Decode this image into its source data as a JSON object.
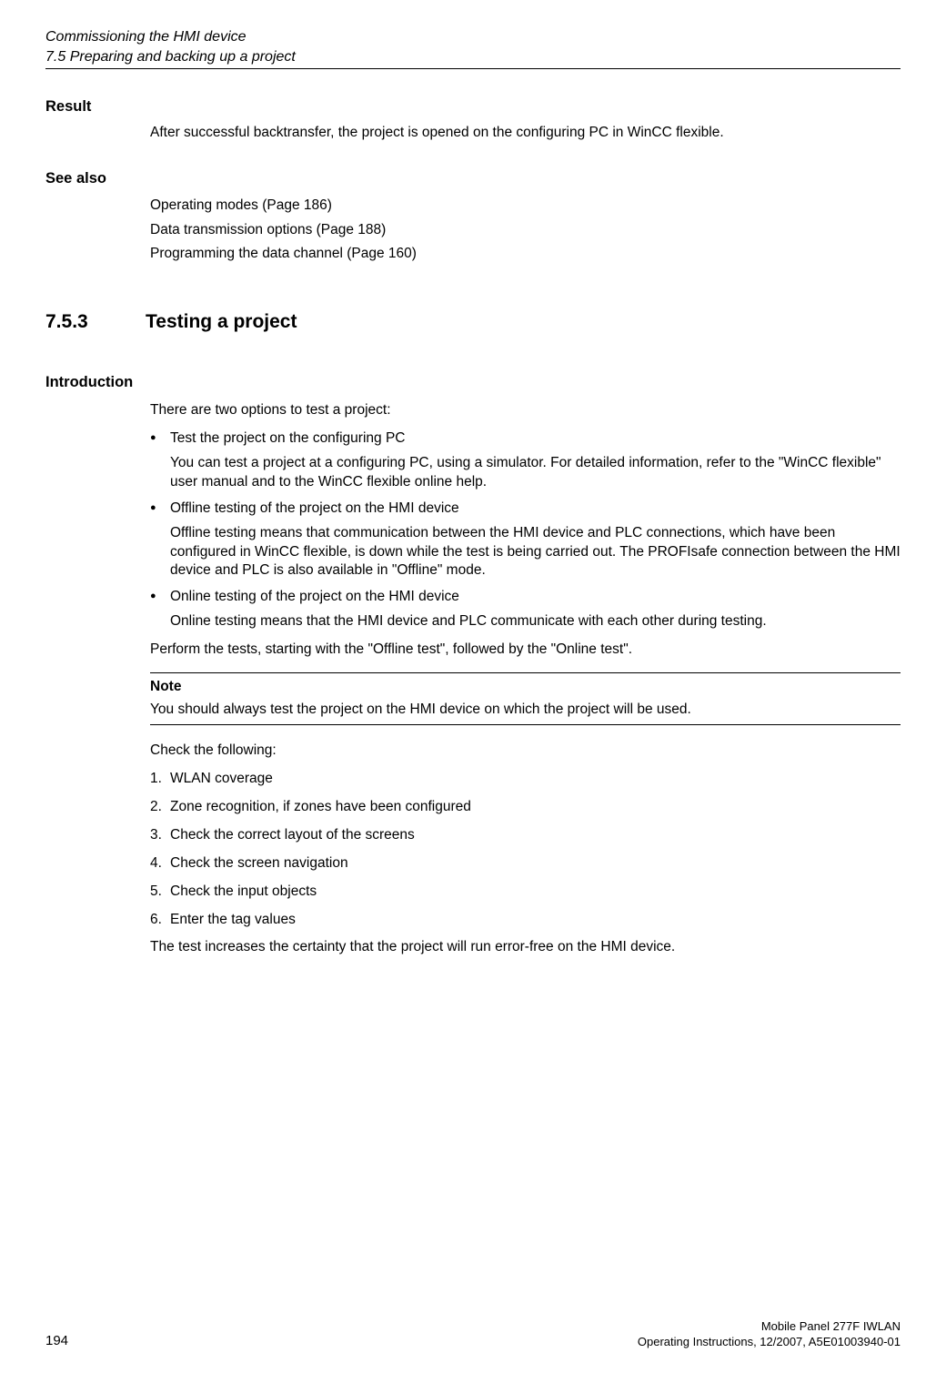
{
  "header": {
    "chapter_title": "Commissioning the HMI device",
    "section_path": "7.5 Preparing and backing up a project"
  },
  "result": {
    "heading": "Result",
    "text": "After successful backtransfer, the project is opened on the configuring PC in WinCC flexible."
  },
  "see_also": {
    "heading": "See also",
    "items": [
      "Operating modes (Page 186)",
      "Data transmission options (Page 188)",
      "Programming the data channel (Page 160)"
    ]
  },
  "chapter": {
    "number": "7.5.3",
    "title": "Testing a project"
  },
  "intro": {
    "heading": "Introduction",
    "lead": "There are two options to test a project:",
    "bullets": [
      {
        "title": "Test the project on the configuring PC",
        "desc": "You can test a project at a configuring PC, using a simulator. For detailed information, refer to the \"WinCC flexible\" user manual and to the WinCC flexible online help."
      },
      {
        "title": "Offline testing of the project on the HMI device",
        "desc": "Offline testing means that communication between the HMI device and PLC connections, which have been configured in WinCC flexible, is down while the test is being carried out. The PROFIsafe connection between the HMI device and PLC is also available in \"Offline\" mode."
      },
      {
        "title": "Online testing of the project on the HMI device",
        "desc": "Online testing means that the HMI device and PLC communicate with each other during testing."
      }
    ],
    "after_bullets": "Perform the tests, starting with the \"Offline test\", followed by the \"Online test\".",
    "note_label": "Note",
    "note_text": "You should always test the project on the HMI device on which the project will be used.",
    "check_label": "Check the following:",
    "checklist": [
      "WLAN coverage",
      "Zone recognition, if zones have been configured",
      "Check the correct layout of the screens",
      "Check the screen navigation",
      "Check the input objects",
      "Enter the tag values"
    ],
    "check_closing": "The test increases the certainty that the project will run error-free on the HMI device."
  },
  "footer": {
    "page_number": "194",
    "doc_name": "Mobile Panel 277F IWLAN",
    "doc_info": "Operating Instructions, 12/2007, A5E01003940-01"
  }
}
